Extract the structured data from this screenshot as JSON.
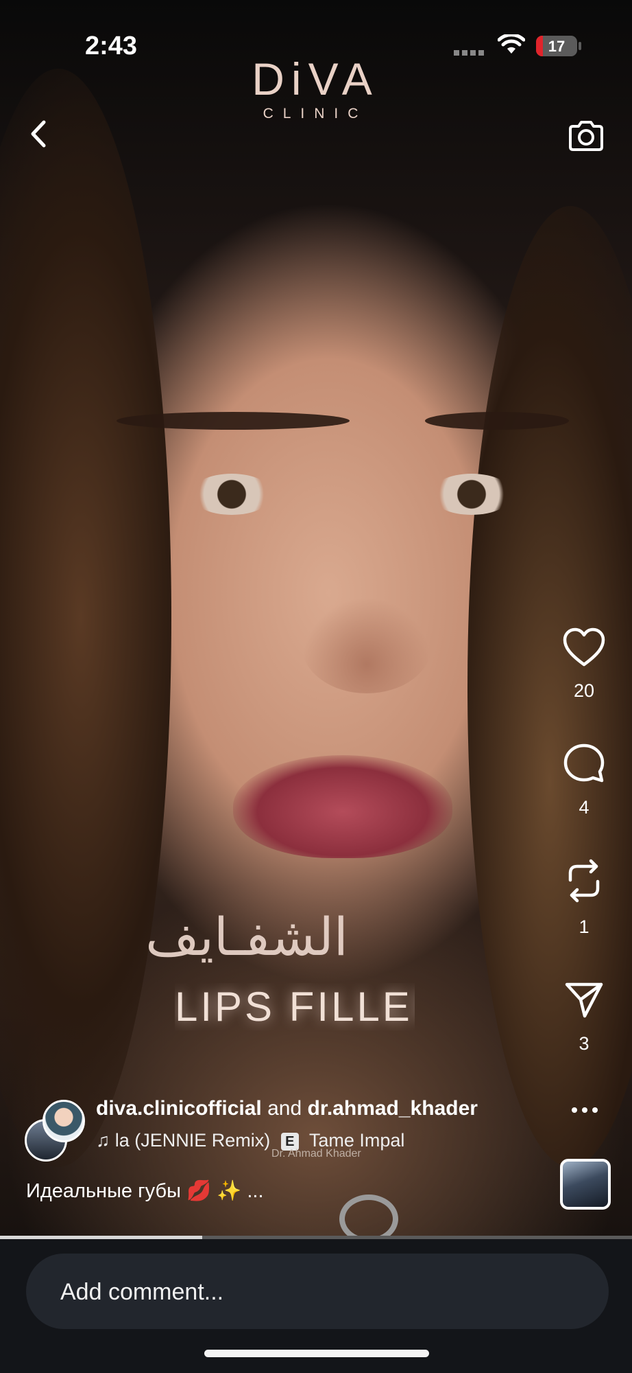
{
  "status_bar": {
    "time": "2:43",
    "battery_level": "17"
  },
  "brand": {
    "line1": "DiVA",
    "line2": "CLINIC"
  },
  "video": {
    "overlay_arabic": "الشفـايف",
    "overlay_english": "LIPS FILLER",
    "watermark_line1": "Dr. Ahmad Khader",
    "progress": 0.32
  },
  "actions": {
    "likes": "20",
    "comments": "4",
    "reposts": "1",
    "shares": "3"
  },
  "post": {
    "user1": "diva.clinicofficial",
    "connector": "and",
    "user2": "dr.ahmad_khader",
    "music_track": "la (JENNIE Remix)",
    "music_badge": "E",
    "music_artist": "Tame Impal",
    "caption": "Идеальные губы 💋 ✨ ..."
  },
  "comment": {
    "placeholder": "Add comment..."
  },
  "icons": {
    "back": "chevron-left-icon",
    "camera": "camera-icon",
    "heart": "heart-icon",
    "comment": "comment-bubble-icon",
    "repost": "repost-icon",
    "share": "paper-plane-icon",
    "more": "more-dots-icon",
    "music": "music-note-icon"
  },
  "colors": {
    "battery_low": "#e0242b",
    "logo": "#e9d1c6",
    "bottom_bar": "#131519"
  }
}
